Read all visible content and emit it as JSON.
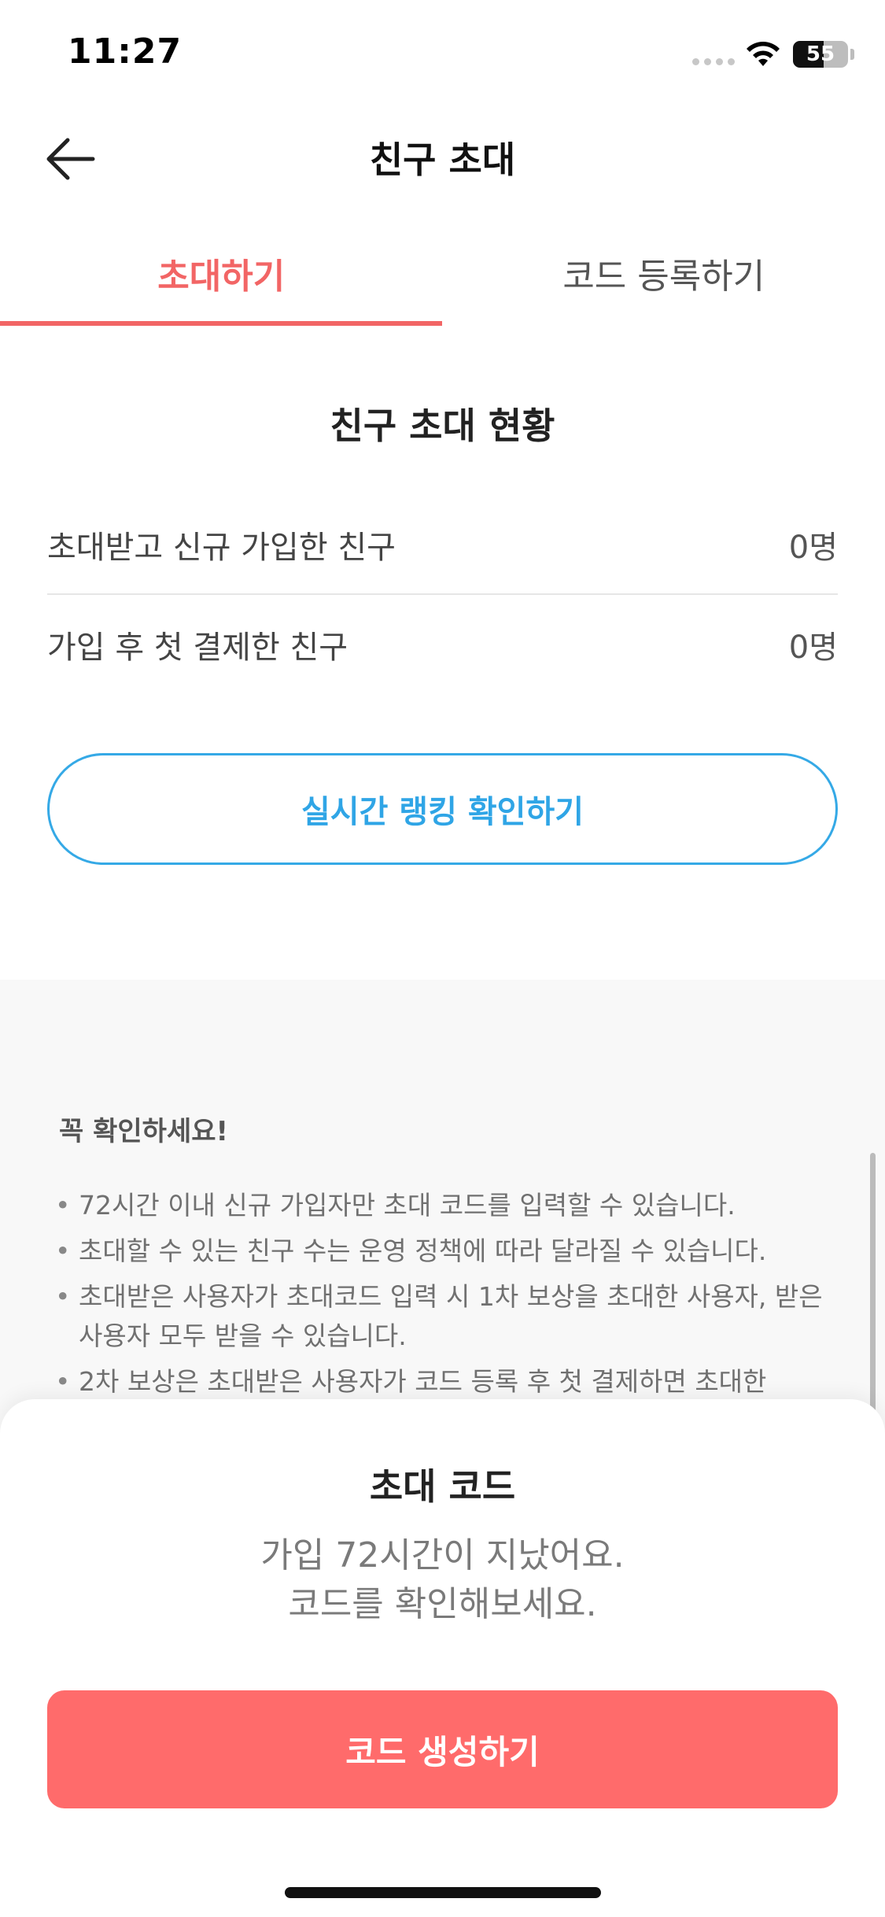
{
  "status_bar": {
    "time": "11:27",
    "battery_level": "55",
    "battery_percent": 55
  },
  "header": {
    "title": "친구 초대",
    "back_icon": "arrow-left-icon"
  },
  "tabs": [
    {
      "label": "초대하기",
      "active": true
    },
    {
      "label": "코드 등록하기",
      "active": false
    }
  ],
  "invite_status": {
    "title": "친구 초대 현황",
    "rows": [
      {
        "label": "초대받고 신규 가입한 친구",
        "value": "0명"
      },
      {
        "label": "가입 후 첫 결제한 친구",
        "value": "0명"
      }
    ],
    "ranking_button_label": "실시간 랭킹 확인하기"
  },
  "notice": {
    "title": "꼭 확인하세요!",
    "items": [
      "72시간 이내 신규 가입자만 초대 코드를 입력할 수 있습니다.",
      "초대할 수 있는 친구 수는 운영 정책에 따라 달라질 수 있습니다.",
      "초대받은 사용자가 초대코드 입력 시 1차 보상을 초대한 사용자, 받은 사용자 모두 받을 수 있습니다.",
      "2차 보상은 초대받은 사용자가 코드 등록 후 첫 결제하면 초대한"
    ]
  },
  "bottom_sheet": {
    "title": "초대 코드",
    "message_line1": "가입 72시간이 지났어요.",
    "message_line2": "코드를 확인해보세요.",
    "button_label": "코드 생성하기"
  },
  "colors": {
    "accent": "#f26565",
    "button": "#ff6b6b",
    "link_blue": "#35a9e6"
  }
}
